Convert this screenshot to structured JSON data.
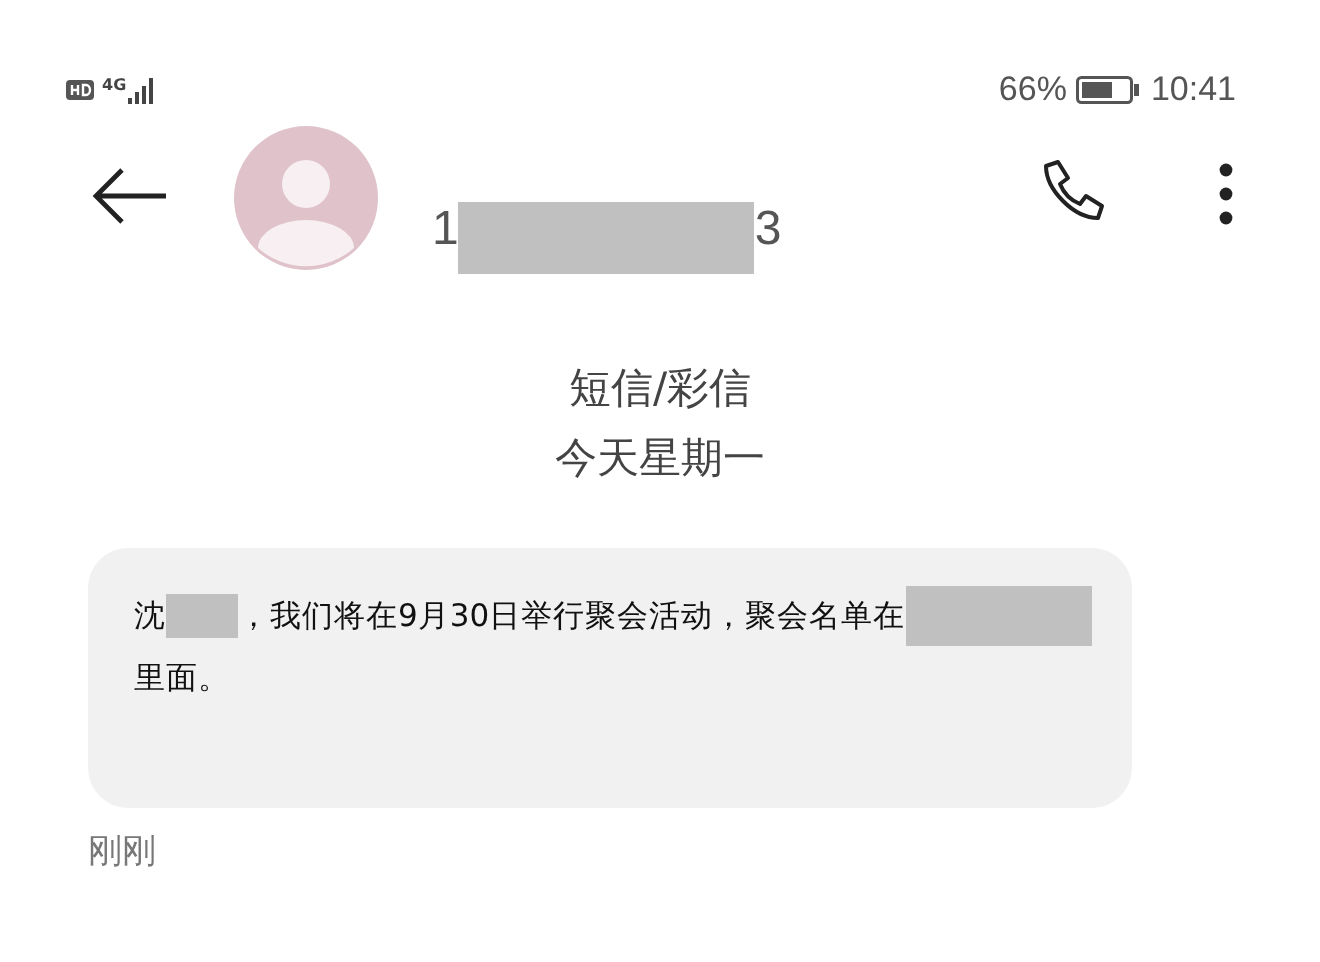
{
  "status_bar": {
    "network": "4G",
    "battery": "66%",
    "time": "10:41"
  },
  "header": {
    "number_parts": [
      {
        "kind": "text",
        "text": "1"
      },
      {
        "kind": "redaction"
      },
      {
        "kind": "text",
        "text": "3"
      }
    ]
  },
  "thread": {
    "channel": "短信/彩信",
    "date": "今天星期一"
  },
  "messages": [
    {
      "parts": [
        {
          "kind": "text",
          "text": "沈"
        },
        {
          "kind": "redaction"
        },
        {
          "kind": "text",
          "text": "，我们将在9月30日举行聚会活动，聚会名单在"
        },
        {
          "kind": "redaction"
        },
        {
          "kind": "text",
          "text": "里面。"
        }
      ],
      "time": "刚刚"
    }
  ]
}
